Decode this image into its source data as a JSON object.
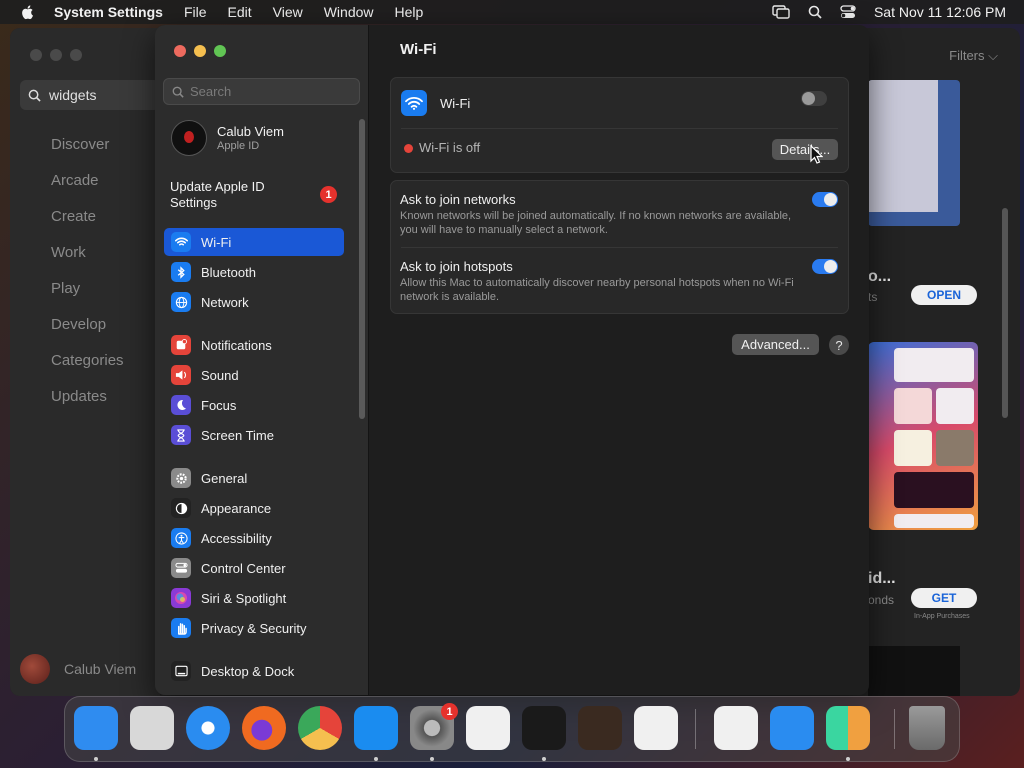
{
  "menubar": {
    "app_name": "System Settings",
    "menus": [
      "File",
      "Edit",
      "View",
      "Window",
      "Help"
    ],
    "clock": "Sat Nov 11  12:06 PM"
  },
  "appstore": {
    "search_value": "widgets",
    "nav": [
      "Discover",
      "Arcade",
      "Create",
      "Work",
      "Play",
      "Develop",
      "Categories",
      "Updates"
    ],
    "user_name": "Calub Viem",
    "filters_label": "Filters",
    "app1_title": "o...",
    "app1_sub": "ts",
    "app1_button": "OPEN",
    "app2_title": "id...",
    "app2_sub": "onds",
    "app2_button": "GET",
    "app2_iap": "In-App Purchases"
  },
  "settings": {
    "search_placeholder": "Search",
    "account_name": "Calub Viem",
    "account_sub": "Apple ID",
    "update_label": "Update Apple ID Settings",
    "update_badge": "1",
    "sidebar": [
      {
        "label": "Wi-Fi",
        "icon": "wifi-icon",
        "color": "#1a7cf0"
      },
      {
        "label": "Bluetooth",
        "icon": "bluetooth-icon",
        "color": "#1a7cf0"
      },
      {
        "label": "Network",
        "icon": "globe-icon",
        "color": "#1a7cf0"
      },
      {
        "label": "Notifications",
        "icon": "bell-icon",
        "color": "#e5443a"
      },
      {
        "label": "Sound",
        "icon": "speaker-icon",
        "color": "#e5443a"
      },
      {
        "label": "Focus",
        "icon": "moon-icon",
        "color": "#5a4ed6"
      },
      {
        "label": "Screen Time",
        "icon": "hourglass-icon",
        "color": "#5a4ed6"
      },
      {
        "label": "General",
        "icon": "gear-icon",
        "color": "#8a8a8a"
      },
      {
        "label": "Appearance",
        "icon": "appearance-icon",
        "color": "#222222"
      },
      {
        "label": "Accessibility",
        "icon": "accessibility-icon",
        "color": "#1a7cf0"
      },
      {
        "label": "Control Center",
        "icon": "control-center-icon",
        "color": "#8a8a8a"
      },
      {
        "label": "Siri & Spotlight",
        "icon": "siri-icon",
        "color": "#8a3ad6"
      },
      {
        "label": "Privacy & Security",
        "icon": "hand-icon",
        "color": "#1a7cf0"
      },
      {
        "label": "Desktop & Dock",
        "icon": "dock-icon",
        "color": "#222222"
      }
    ],
    "pane_title": "Wi-Fi",
    "wifi_label": "Wi-Fi",
    "wifi_status": "Wi-Fi is off",
    "details_button": "Details...",
    "ask_networks_title": "Ask to join networks",
    "ask_networks_desc": "Known networks will be joined automatically. If no known networks are available, you will have to manually select a network.",
    "ask_hotspots_title": "Ask to join hotspots",
    "ask_hotspots_desc": "Allow this Mac to automatically discover nearby personal hotspots when no Wi-Fi network is available.",
    "advanced_button": "Advanced...",
    "help_button": "?"
  },
  "dock": {
    "apps": [
      {
        "name": "finder-icon",
        "color": "#2f8cf0"
      },
      {
        "name": "launchpad-icon",
        "color": "#d8d8d8"
      },
      {
        "name": "safari-icon",
        "color": "#2a8cf0"
      },
      {
        "name": "firefox-icon",
        "color": "#f06a20"
      },
      {
        "name": "chrome-icon",
        "color": "#f0f0f0"
      },
      {
        "name": "app-store-icon",
        "color": "#1a8cf0"
      },
      {
        "name": "system-settings-icon",
        "color": "#6a6a6a"
      },
      {
        "name": "textedit-icon",
        "color": "#f0f0f0"
      },
      {
        "name": "terminal-icon",
        "color": "#1a1a1a"
      },
      {
        "name": "garageband-icon",
        "color": "#3a2a20"
      },
      {
        "name": "vscode-icon",
        "color": "#f0f0f0"
      },
      {
        "name": "visual-studio-icon",
        "color": "#f0f0f0"
      },
      {
        "name": "weather-icon",
        "color": "#2a8cf0"
      },
      {
        "name": "widget-app-icon",
        "color": "#f0f0f0"
      },
      {
        "name": "trash-icon",
        "color": "#8a8a8a"
      }
    ],
    "settings_badge": "1"
  }
}
